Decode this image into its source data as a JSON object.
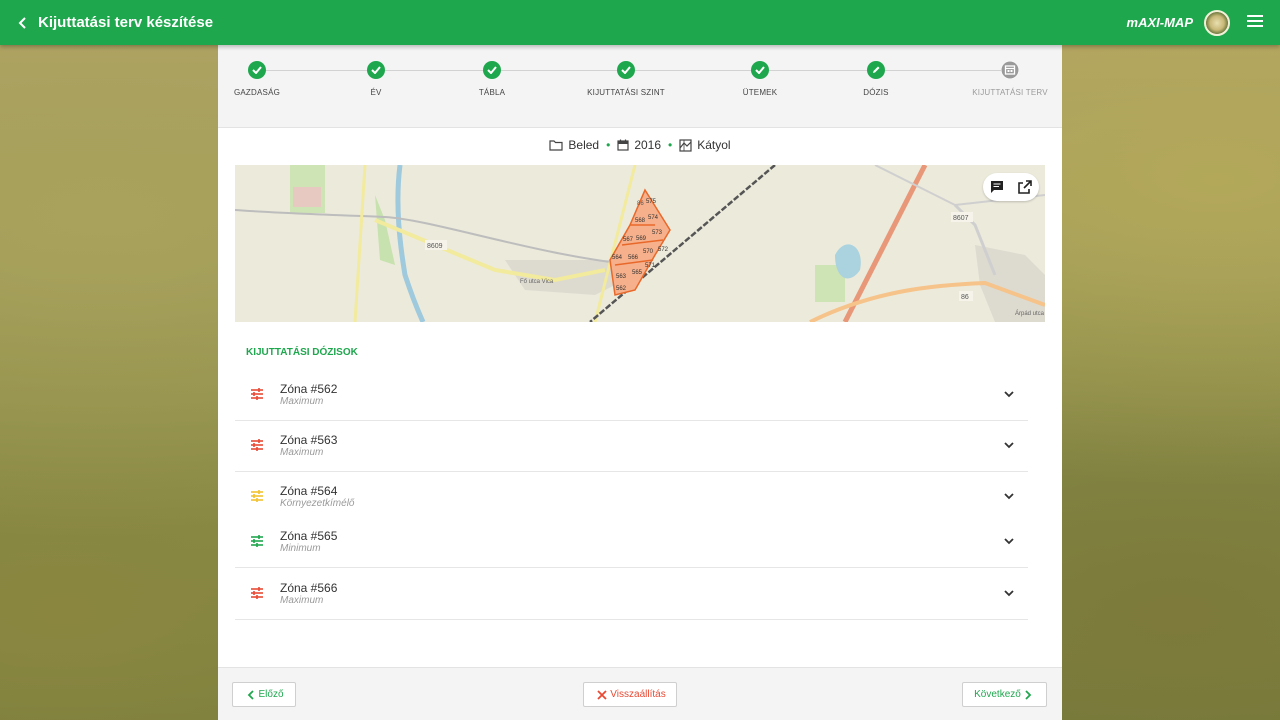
{
  "header": {
    "title": "Kijuttatási terv készítése",
    "brand": "mAXI-MAP"
  },
  "steps": [
    {
      "label": "GAZDASÁG",
      "state": "done"
    },
    {
      "label": "ÉV",
      "state": "done"
    },
    {
      "label": "TÁBLA",
      "state": "done"
    },
    {
      "label": "KIJUTTATÁSI SZINT",
      "state": "done"
    },
    {
      "label": "ÜTEMEK",
      "state": "done"
    },
    {
      "label": "DÓZIS",
      "state": "editing"
    },
    {
      "label": "KIJUTTATÁSI TERV",
      "state": "pending"
    }
  ],
  "breadcrumb": {
    "farm": "Beled",
    "year": "2016",
    "field": "Kátyol"
  },
  "map": {
    "road_labels": [
      "8609",
      "8607",
      "86",
      "86",
      "Fő utca Vica",
      "Árpád utca"
    ],
    "zone_labels": [
      "575",
      "574",
      "568",
      "573",
      "567",
      "569",
      "570",
      "572",
      "564",
      "566",
      "571",
      "563",
      "565",
      "562"
    ]
  },
  "doses": {
    "title": "KIJUTTATÁSI DÓZISOK",
    "zones": [
      {
        "name": "Zóna #562",
        "level": "Maximum",
        "color": "#e84a34"
      },
      {
        "name": "Zóna #563",
        "level": "Maximum",
        "color": "#e84a34"
      },
      {
        "name": "Zóna #564",
        "level": "Környezetkímélő",
        "color": "#f2c12e"
      },
      {
        "name": "Zóna #565",
        "level": "Minimum",
        "color": "#1fa74e"
      },
      {
        "name": "Zóna #566",
        "level": "Maximum",
        "color": "#e84a34"
      }
    ]
  },
  "footer": {
    "prev": "Előző",
    "reset": "Visszaállítás",
    "next": "Következő"
  },
  "colors": {
    "accent": "#1fa74e",
    "danger": "#e84a34",
    "warning": "#f2c12e"
  }
}
